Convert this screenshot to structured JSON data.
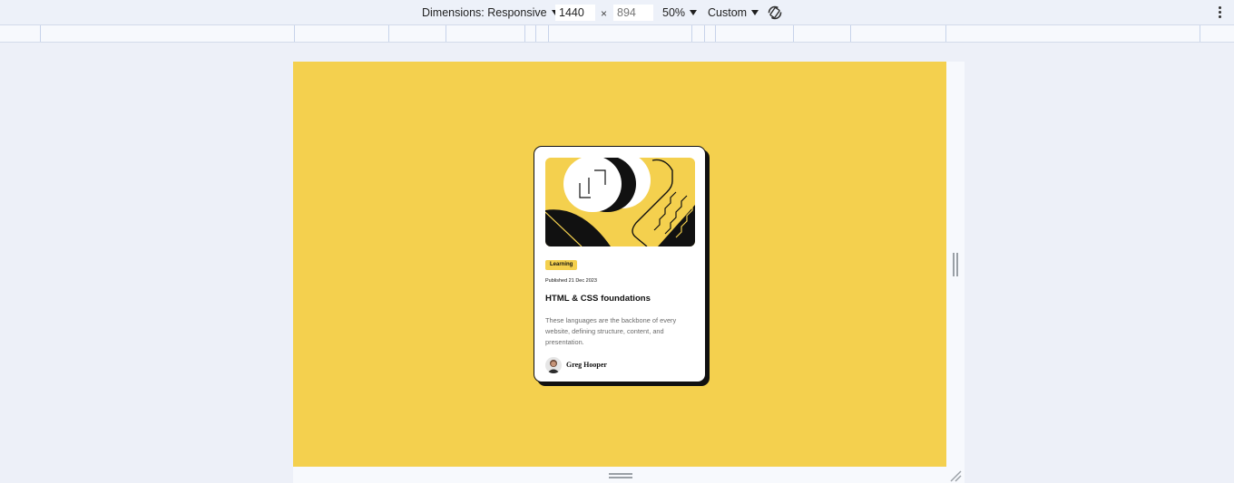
{
  "toolbar": {
    "dimensions_label": "Dimensions: Responsive",
    "width_value": "1440",
    "height_placeholder": "894",
    "times_symbol": "×",
    "zoom_label": "50%",
    "throttle_label": "Custom",
    "rotate_icon": "rotate-icon",
    "more_icon": "kebab-menu-icon"
  },
  "colors": {
    "page_background": "#f4d04e",
    "card_background": "#ffffff",
    "ink": "#111111",
    "badge": "#f4d04e",
    "devtools_bg": "#edf1f9"
  },
  "card": {
    "badge": "Learning",
    "published": "Published 21 Dec 2023",
    "title": "HTML & CSS foundations",
    "description": "These languages are the backbone of every website, defining structure, content, and presentation.",
    "author": "Greg Hooper"
  }
}
